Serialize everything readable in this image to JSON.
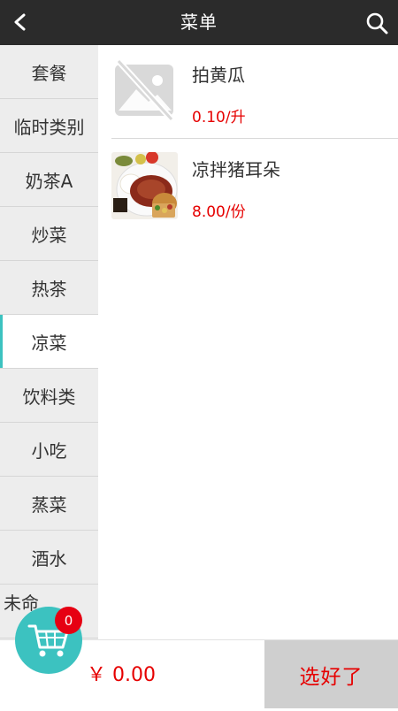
{
  "header": {
    "title": "菜单",
    "back_icon": "chevron-left-icon",
    "search_icon": "search-icon"
  },
  "sidebar": {
    "items": [
      {
        "label": "套餐"
      },
      {
        "label": "临时类别"
      },
      {
        "label": "奶茶A"
      },
      {
        "label": "炒菜"
      },
      {
        "label": "热茶"
      },
      {
        "label": "凉菜",
        "active": true
      },
      {
        "label": "饮料类"
      },
      {
        "label": "小吃"
      },
      {
        "label": "蒸菜"
      },
      {
        "label": "酒水"
      },
      {
        "label": "未命"
      }
    ],
    "accent_color": "#3cc2c0"
  },
  "menu": {
    "items": [
      {
        "name": "拍黄瓜",
        "price": "0.10/升",
        "image": "image-placeholder-icon"
      },
      {
        "name": "凉拌猪耳朵",
        "price": "8.00/份",
        "image": "dish-photo"
      }
    ],
    "price_color": "#e60000"
  },
  "cart": {
    "count": "0",
    "total": "￥ 0.00",
    "icon": "shopping-cart-icon"
  },
  "actions": {
    "confirm_label": "选好了"
  }
}
